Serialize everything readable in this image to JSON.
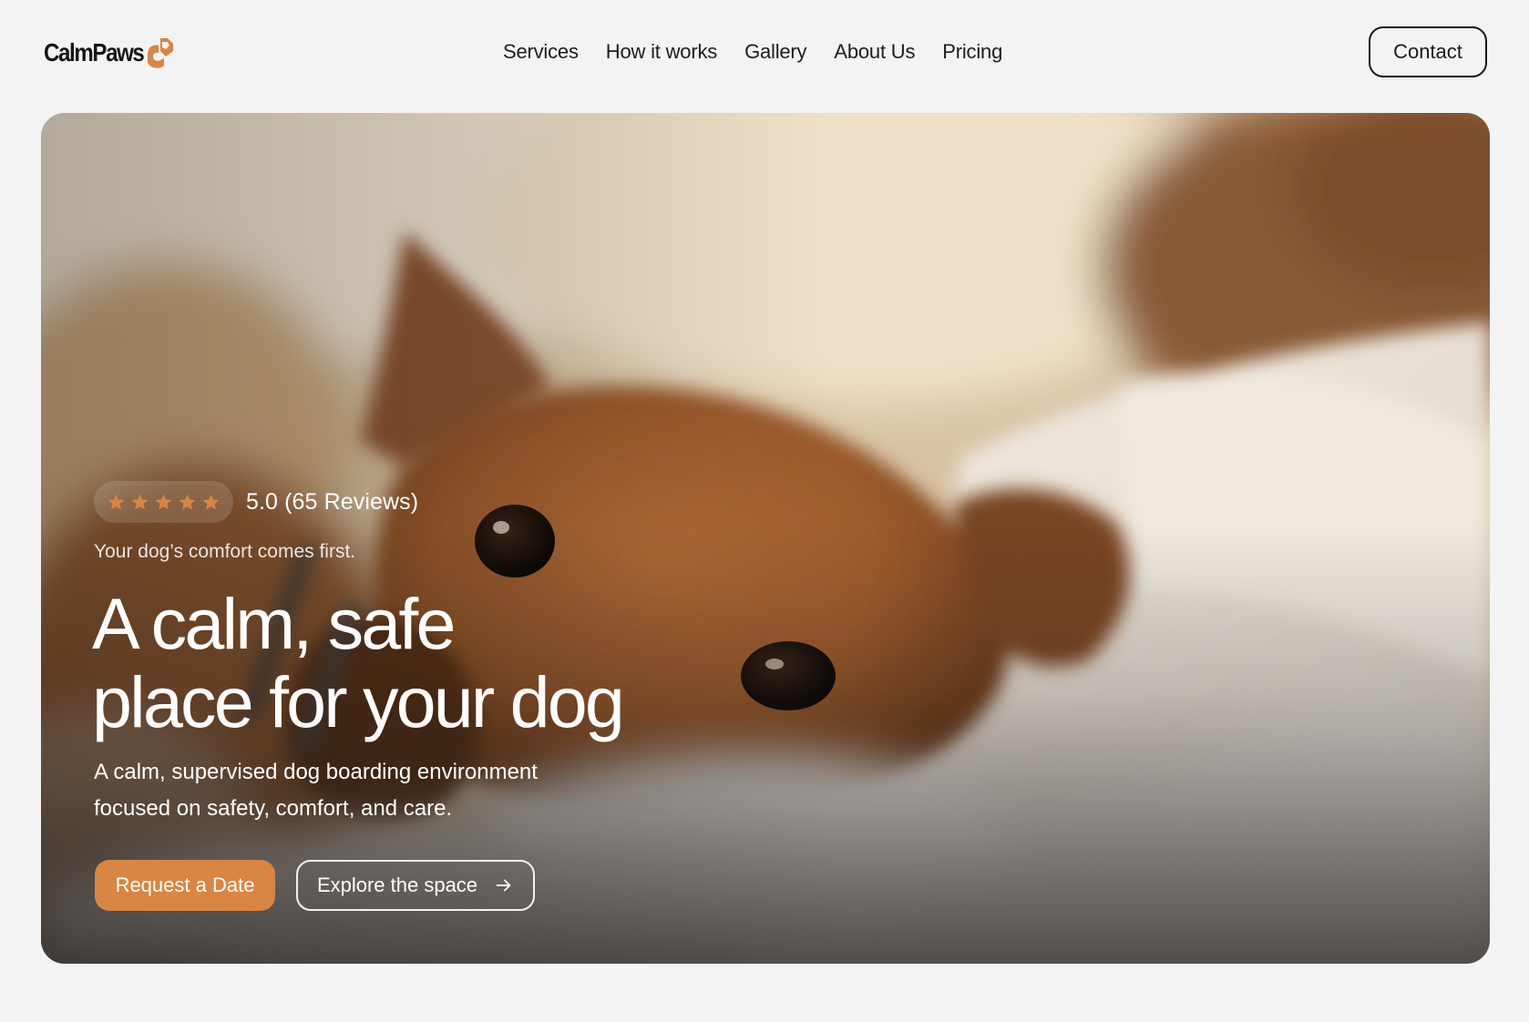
{
  "brand": {
    "name": "CalmPaws",
    "accent": "#d98543"
  },
  "nav": {
    "items": [
      "Services",
      "How it works",
      "Gallery",
      "About Us",
      "Pricing"
    ]
  },
  "header": {
    "contact_label": "Contact"
  },
  "hero": {
    "rating": {
      "stars": 5,
      "text": "5.0 (65 Reviews)",
      "star_icon": "star-icon"
    },
    "eyebrow": "Your dog’s comfort comes first.",
    "headline_line1": "A calm, safe",
    "headline_line2": "place for your dog",
    "subcopy": "A calm, supervised dog boarding environment focused on safety, comfort, and care.",
    "primary_cta": "Request a Date",
    "secondary_cta": "Explore the space",
    "secondary_cta_icon": "arrow-right-icon",
    "colors": {
      "overlay_text": "#ffffff",
      "button_fill": "#d98543"
    }
  }
}
